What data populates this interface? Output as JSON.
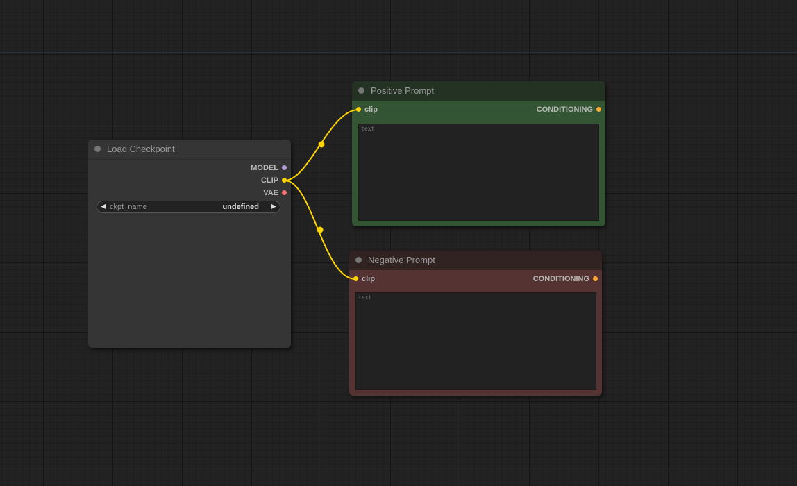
{
  "nodes": {
    "load_checkpoint": {
      "title": "Load Checkpoint",
      "outputs": [
        "MODEL",
        "CLIP",
        "VAE"
      ],
      "widget": {
        "name": "ckpt_name",
        "value": "undefined"
      }
    },
    "positive_prompt": {
      "title": "Positive Prompt",
      "input": "clip",
      "output": "CONDITIONING",
      "text_placeholder": "text"
    },
    "negative_prompt": {
      "title": "Negative Prompt",
      "input": "clip",
      "output": "CONDITIONING",
      "text_placeholder": "text"
    }
  },
  "colors": {
    "canvas_bg": "#222222",
    "node_bg": "#353535",
    "positive_title": "#233223",
    "positive_body": "#335533",
    "negative_title": "#322323",
    "negative_body": "#553333",
    "clip_wire": "#FFD500",
    "model_slot": "#B39DDB",
    "clip_slot": "#FFD500",
    "vae_slot": "#FF6E6E",
    "conditioning_slot": "#FFA931"
  }
}
